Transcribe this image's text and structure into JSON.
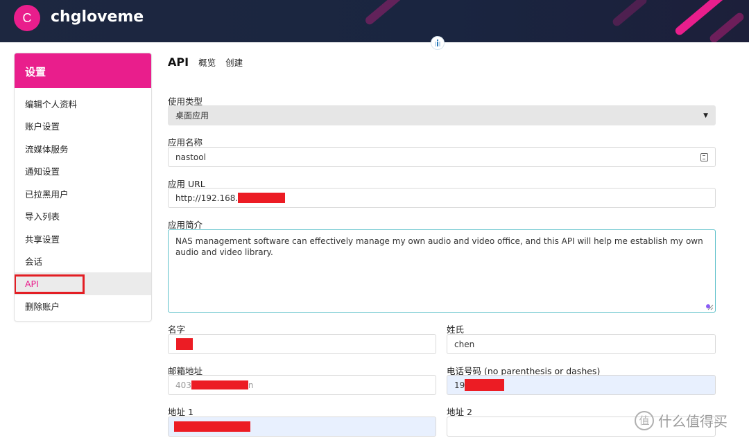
{
  "header": {
    "avatar_letter": "C",
    "username": "chgloveme",
    "brand_color": "#e91e8c"
  },
  "sidebar": {
    "title": "设置",
    "items": [
      {
        "label": "编辑个人资料"
      },
      {
        "label": "账户设置"
      },
      {
        "label": "流媒体服务"
      },
      {
        "label": "通知设置"
      },
      {
        "label": "已拉黑用户"
      },
      {
        "label": "导入列表"
      },
      {
        "label": "共享设置"
      },
      {
        "label": "会话"
      },
      {
        "label": "API",
        "active": true
      },
      {
        "label": "删除账户"
      }
    ]
  },
  "tabs": {
    "current": "API",
    "overview": "概览",
    "create": "创建"
  },
  "form": {
    "usage_type_label": "使用类型",
    "usage_type_value": "桌面应用",
    "app_name_label": "应用名称",
    "app_name_value": "nastool",
    "app_url_label": "应用 URL",
    "app_url_value": "http://192.168.",
    "app_intro_label": "应用简介",
    "app_intro_value": "NAS management software can effectively manage my own audio and video office, and this API will help me establish my own audio and video library.",
    "first_name_label": "名字",
    "last_name_label": "姓氏",
    "last_name_value": "chen",
    "email_label": "邮箱地址",
    "email_prefix": "403",
    "email_suffix": "n",
    "phone_label": "电话号码 (no parenthesis or dashes)",
    "phone_prefix": "19",
    "address1_label": "地址 1",
    "address2_label": "地址 2"
  },
  "watermark": {
    "icon_char": "值",
    "text": "什么值得买"
  }
}
